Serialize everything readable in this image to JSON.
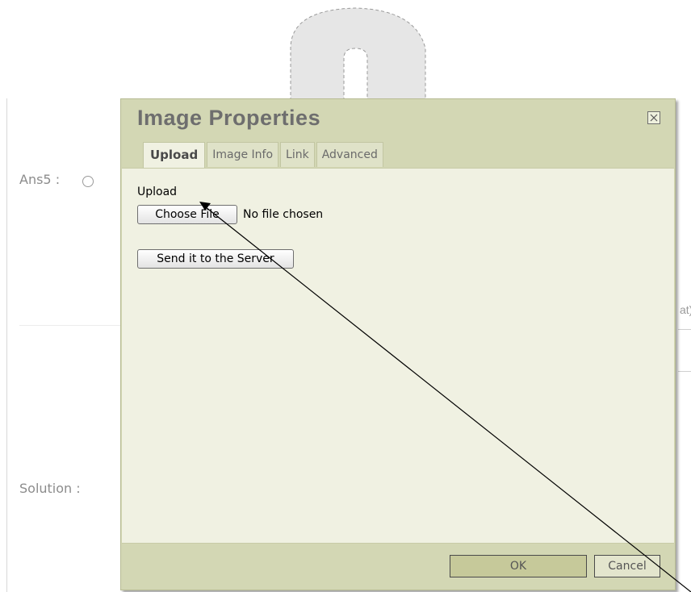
{
  "background": {
    "ans5_label": "Ans5 :",
    "solution_label": "Solution :",
    "right_partial_text": "at)"
  },
  "dialog": {
    "title": "Image Properties",
    "tabs": [
      {
        "label": "Upload",
        "active": true
      },
      {
        "label": "Image Info",
        "active": false
      },
      {
        "label": "Link",
        "active": false
      },
      {
        "label": "Advanced",
        "active": false
      }
    ],
    "upload": {
      "section_label": "Upload",
      "choose_button": "Choose File",
      "file_status": "No file chosen",
      "send_button": "Send it to the Server"
    },
    "footer": {
      "ok_label": "OK",
      "cancel_label": "Cancel"
    }
  },
  "colors": {
    "dialog_bg": "#d3d7b4",
    "content_bg": "#f0f1e2",
    "ok_bg": "#c6c99a"
  },
  "icons": {
    "close": "close-icon",
    "radio": "radio-icon",
    "annotation_arrow": "arrow-icon"
  }
}
